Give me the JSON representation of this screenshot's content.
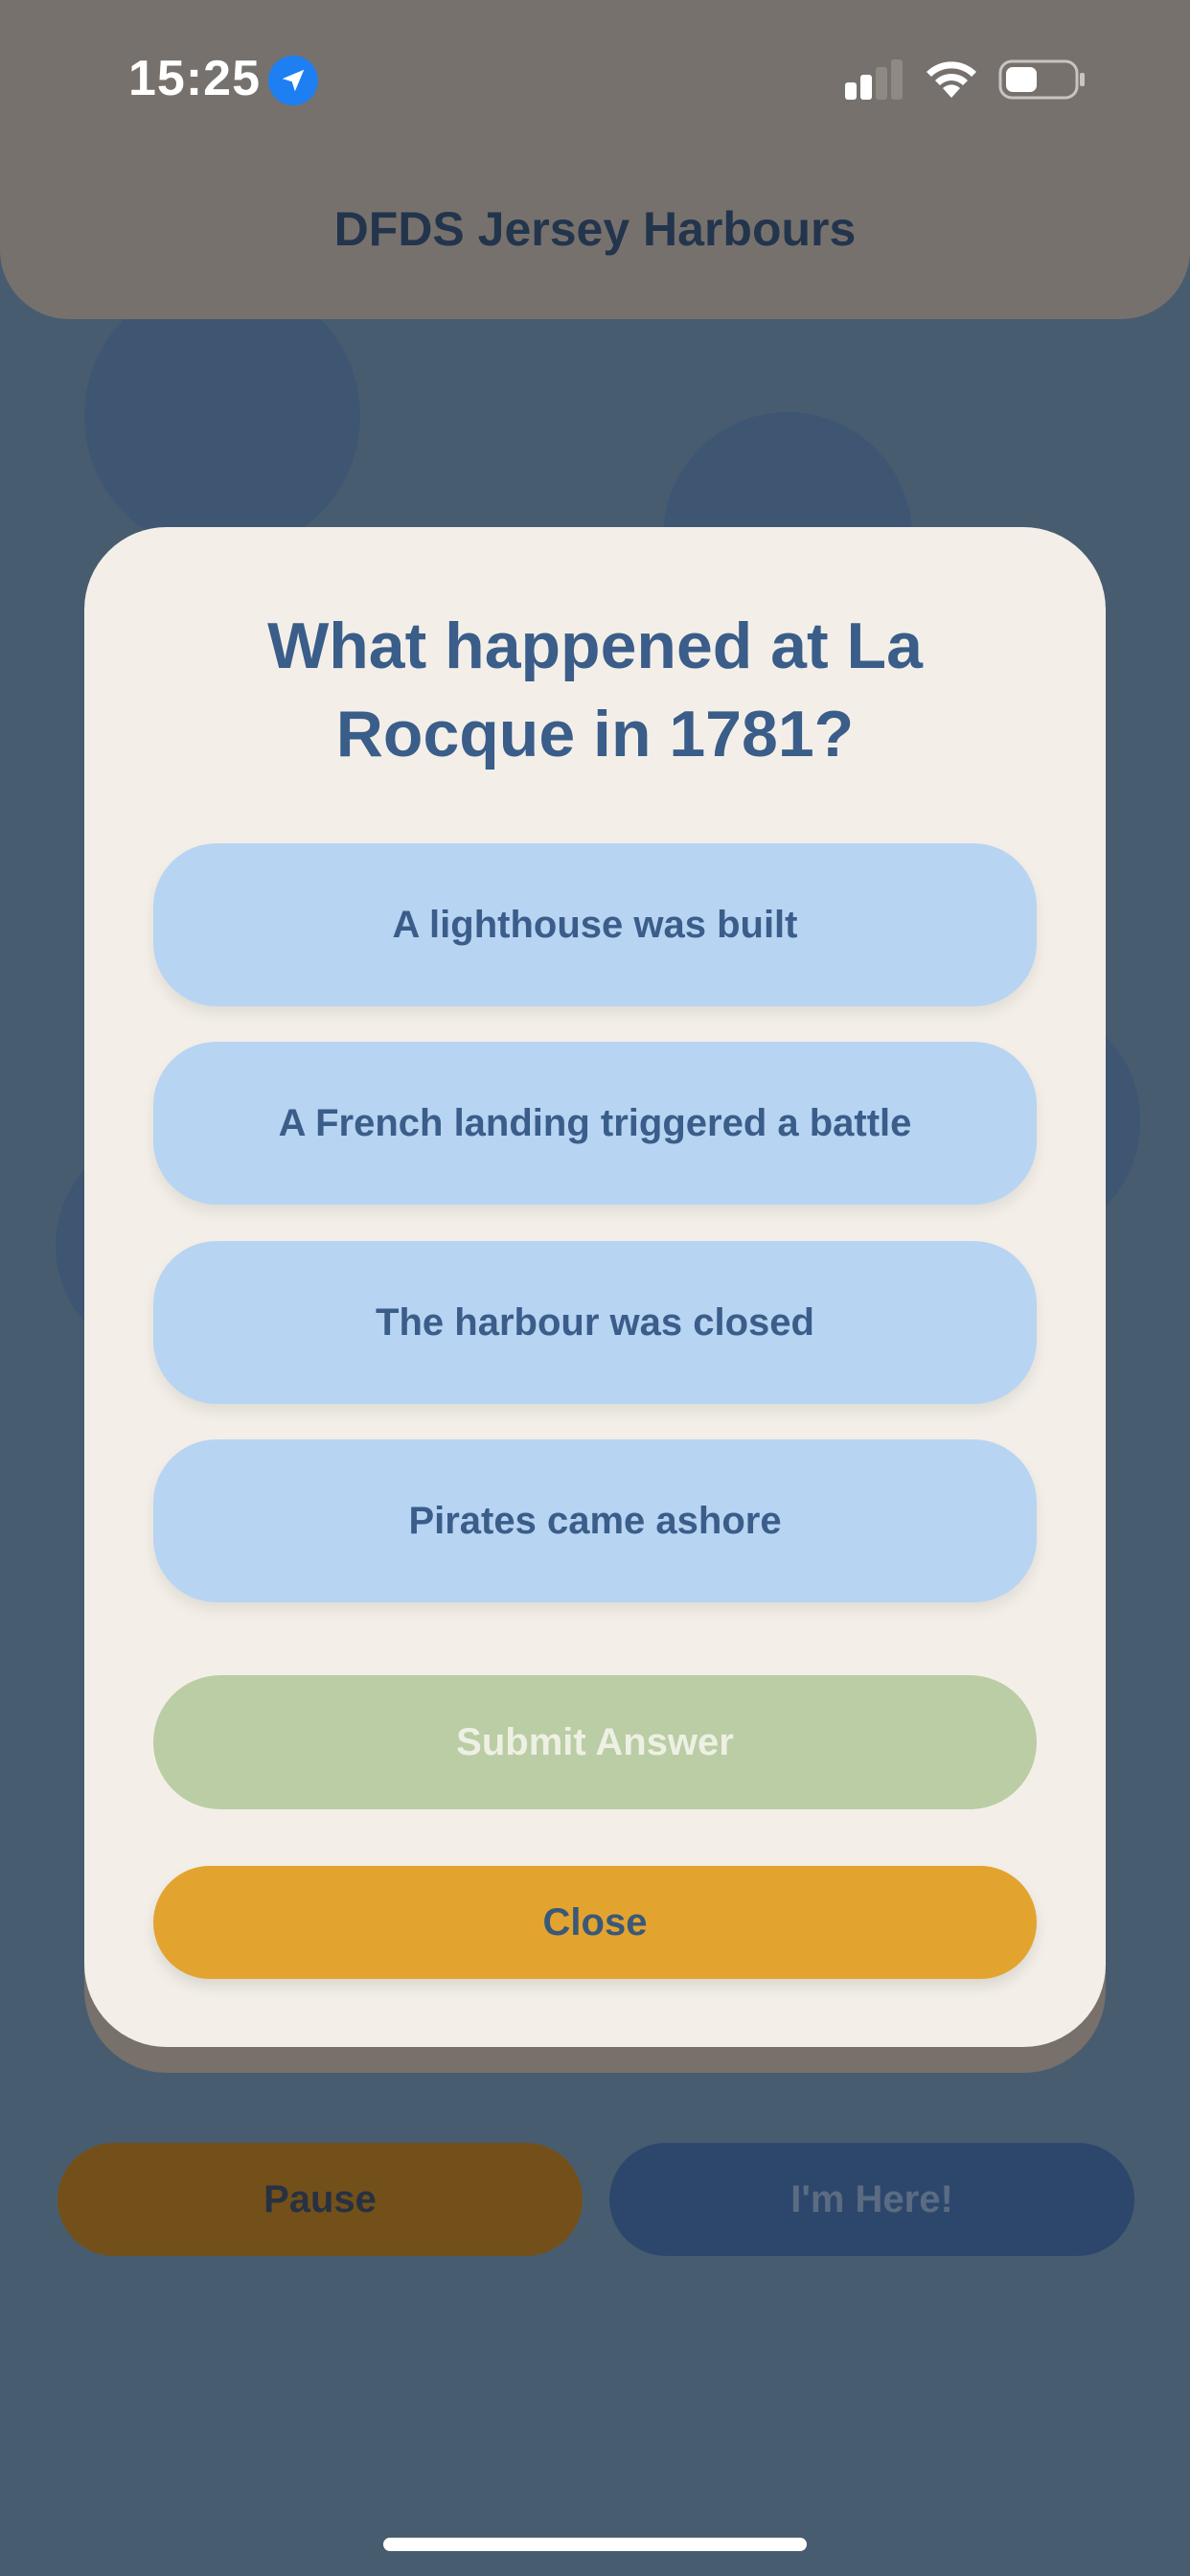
{
  "status_bar": {
    "time": "15:25",
    "location_icon": "location-arrow-icon",
    "signal_icon": "cellular-signal-icon",
    "wifi_icon": "wifi-icon",
    "battery_icon": "battery-icon"
  },
  "header": {
    "title": "DFDS Jersey Harbours"
  },
  "quiz": {
    "question": "What happened at La Rocque in 1781?",
    "options": [
      "A lighthouse was built",
      "A French landing triggered a battle",
      "The harbour was closed",
      "Pirates came ashore"
    ],
    "submit_label": "Submit Answer",
    "close_label": "Close"
  },
  "footer": {
    "pause_label": "Pause",
    "here_label": "I'm Here!"
  },
  "colors": {
    "header_bg": "#77716d",
    "modal_bg": "#f3efe8",
    "option_bg": "#b8d4f3",
    "submit_bg": "#bacda5",
    "close_bg": "#e3a32f",
    "text_primary": "#3a5d89"
  }
}
